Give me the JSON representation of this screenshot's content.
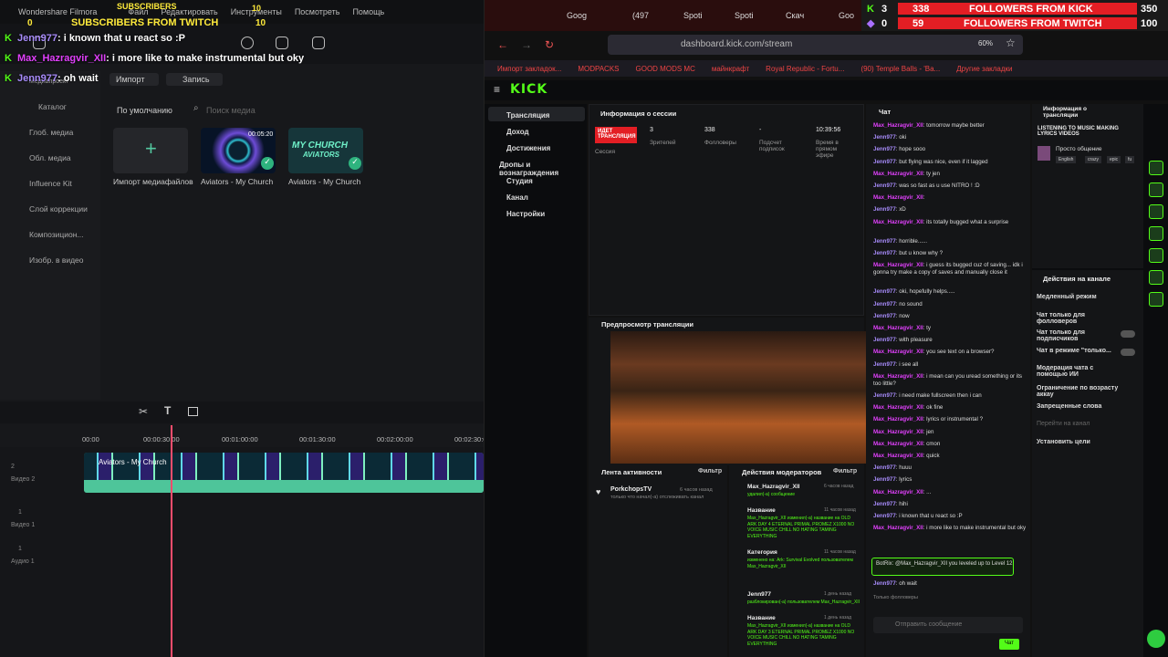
{
  "filmora": {
    "app_title": "Wondershare Filmora",
    "menu": [
      "Файл",
      "Редактировать",
      "Инструменты",
      "Посмотреть",
      "Помощь"
    ],
    "import_label": "Импорт",
    "record_label": "Запись",
    "sort_label": "По умолчанию",
    "search_placeholder": "Поиск медиа",
    "side_items": [
      "Медиапроект",
      "Каталог",
      "Глоб. медиа",
      "Обл. медиа",
      "Influence Kit",
      "Слой коррекции",
      "Композицион...",
      "Изобр. в видео"
    ],
    "import_media_label": "Импорт медиафайлов",
    "media": [
      {
        "name": "Aviators - My Church",
        "duration": "00:05:20"
      },
      {
        "name": "Aviators - My Church",
        "overlay": "MY CHURCH",
        "overlay2": "AVIATORS"
      }
    ],
    "ruler": [
      "00:00",
      "00:00:30:00",
      "00:01:00:00",
      "00:01:30:00",
      "00:02:00:00",
      "00:02:30:00"
    ],
    "clip_name": "Aviators - My Church",
    "tracks": [
      {
        "num": "2",
        "label": "Видео 2"
      },
      {
        "num": "1",
        "label": "Видео 1"
      },
      {
        "num": "1",
        "label": "Аудио 1"
      }
    ]
  },
  "overlay": {
    "subs_title": "SUBSCRIBERS",
    "subs_count": "10",
    "subs_twitch": "SUBSCRIBERS FROM TWITCH",
    "subs_twitch_count": "10",
    "subs_left": "0",
    "followers": [
      {
        "count_left": "3",
        "label": "FOLLOWERS FROM KICK",
        "count_a": "338",
        "count_b": "350"
      },
      {
        "count_left": "0",
        "label": "FOLLOWERS FROM TWITCH",
        "count_a": "59",
        "count_b": "100"
      }
    ],
    "chat": [
      {
        "user": "Jenn977",
        "msg": ": i known that u react so :P"
      },
      {
        "user": "Max_Hazragvir_XII",
        "msg": ": i more like to make instrumental but oky"
      },
      {
        "user": "Jenn977",
        "msg": ": oh wait"
      }
    ]
  },
  "browser": {
    "tabs": [
      "Goog",
      "(497",
      "Spoti",
      "Spoti",
      "Скач",
      "Goo"
    ],
    "url": "dashboard.kick.com/stream",
    "zoom": "60%",
    "bookmarks": [
      "Импорт закладок...",
      "MODPACKS",
      "GOOD MODS MC",
      "майнкрафт",
      "Royal Republic - Fortu...",
      "(90) Temple Balls - 'Ba...",
      "Другие закладки"
    ]
  },
  "kick": {
    "logo": "KICK",
    "menu": [
      "Трансляция",
      "Доход",
      "Достижения",
      "Дропы и вознаграждения",
      "Студия",
      "Канал",
      "Настройки"
    ],
    "session": {
      "title": "Информация о сессии",
      "live_badge": "ИДЕТ ТРАНСЛЯЦИЯ",
      "session_label": "Сессия",
      "stats": [
        {
          "value": "3",
          "label": "Зрителей"
        },
        {
          "value": "338",
          "label": "Фолловеры"
        },
        {
          "value": "-",
          "label": "Подсчет подписок"
        },
        {
          "value": "10:39:56",
          "label": "Время в прямом эфире"
        }
      ]
    },
    "preview_title": "Предпросмотр трансляции",
    "activity": {
      "title": "Лента активности",
      "filter": "Фильтр",
      "user": "PorkchopsTV",
      "time": "6 часов назад",
      "desc": "только что начал(-а) отслеживать канал"
    },
    "modactions": {
      "title": "Действия модераторов",
      "filter": "Фильтр",
      "items": [
        {
          "head": "Max_Hazragvir_XII",
          "time": "6 часов назад",
          "desc": "удалил(-а) сообщение"
        },
        {
          "head": "Название",
          "time": "11 часов назад",
          "desc": "Max_Hazragvir_XII изменил(-а) название на OLD ARK DAY 4 ETERNAL PRIMAL PROMEZ X1000 NO VOICE MUSIC CHILL NO HATING TAMING EVERYTHING"
        },
        {
          "head": "Категория",
          "time": "11 часов назад",
          "desc": "изменено на: Ark: Survival Evolved пользователем Max_Hazragvir_XII"
        },
        {
          "head": "Jenn977",
          "time": "1 день назад",
          "desc": "разблокирован(-а) пользователем Max_Hazragvir_XII"
        },
        {
          "head": "Название",
          "time": "1 день назад",
          "desc": "Max_Hazragvir_XII изменил(-а) название на OLD ARK DAY 3 ETERNAL PRIMAL PROMEZ X1000 NO VOICE MUSIC CHILL NO HATING TAMING EVERYTHING"
        }
      ]
    },
    "chat": {
      "title": "Чат",
      "messages": [
        {
          "u": "Max_Hazragvir_XII",
          "m": ": tomorrow maybe better"
        },
        {
          "u": "Jenn977",
          "m": ": oki"
        },
        {
          "u": "Jenn977",
          "m": ": hope sooo"
        },
        {
          "u": "Jenn977",
          "m": ": but flying was nice, even if it lagged"
        },
        {
          "u": "Max_Hazragvir_XII",
          "m": ": ty jen"
        },
        {
          "u": "Jenn977",
          "m": ": was so fast as u use NITRO ! :D"
        },
        {
          "u": "Max_Hazragvir_XII",
          "m": ":"
        },
        {
          "u": "Jenn977",
          "m": ": xD"
        },
        {
          "u": "Max_Hazragvir_XII",
          "m": ": its totally bugged what a surprise"
        },
        {
          "u": "Jenn977",
          "m": ": horrible......"
        },
        {
          "u": "Jenn977",
          "m": ": but u know why ?"
        },
        {
          "u": "Max_Hazragvir_XII",
          "m": ": i guess its bugged cuz of saving... idk i gonna try make a copy of saves and manually close it"
        },
        {
          "u": "Jenn977",
          "m": ": oki, hopefully helps....."
        },
        {
          "u": "Jenn977",
          "m": ": no sound"
        },
        {
          "u": "Jenn977",
          "m": ": now"
        },
        {
          "u": "Max_Hazragvir_XII",
          "m": ": ty"
        },
        {
          "u": "Jenn977",
          "m": ": with pleasure"
        },
        {
          "u": "Max_Hazragvir_XII",
          "m": ": you see text on a browser?"
        },
        {
          "u": "Jenn977",
          "m": ": i see all"
        },
        {
          "u": "Max_Hazragvir_XII",
          "m": ": i mean can you uread something or its too little?"
        },
        {
          "u": "Jenn977",
          "m": ": i need make fullscreen then i can"
        },
        {
          "u": "Max_Hazragvir_XII",
          "m": ": ok fine"
        },
        {
          "u": "Max_Hazragvir_XII",
          "m": ": lyrics or instrumental ?"
        },
        {
          "u": "Max_Hazragvir_XII",
          "m": ": jen"
        },
        {
          "u": "Max_Hazragvir_XII",
          "m": ": cmon"
        },
        {
          "u": "Max_Hazragvir_XII",
          "m": ": quick"
        },
        {
          "u": "Jenn977",
          "m": ": huuu"
        },
        {
          "u": "Jenn977",
          "m": ": lyrics"
        },
        {
          "u": "Max_Hazragvir_XII",
          "m": ": ..."
        },
        {
          "u": "Jenn977",
          "m": ": hihi"
        },
        {
          "u": "Jenn977",
          "m": ": i known that u react so :P"
        },
        {
          "u": "Max_Hazragvir_XII",
          "m": ": i more like to make instrumental but oky"
        }
      ],
      "botrix": "BotRix: @Max_Hazragvir_XII you leveled up to Level 12",
      "last": {
        "u": "Jenn977",
        "m": ": oh wait"
      },
      "followers_only": "Только фолловеры",
      "input_placeholder": "Отправить сообщение",
      "send_label": "Чат"
    },
    "info": {
      "title": "Информация о трансляции",
      "stream_title": "LISTENING TO MUSIC MAKING LYRICS VIDEOS",
      "category": "Просто общение",
      "tags": [
        "English",
        "crazy",
        "epic",
        "fu"
      ]
    },
    "actions": {
      "title": "Действия на канале",
      "items": [
        "Медленный режим",
        "Чат только для фолловеров",
        "Чат только для подписчиков",
        "Чат в режиме \"только...",
        "Модерация чата с помощью ИИ",
        "Ограничение по возрасту аккау",
        "Запрещенные слова",
        "Перейти на канал",
        "Установить цели"
      ]
    },
    "accent": "#53fc18"
  }
}
